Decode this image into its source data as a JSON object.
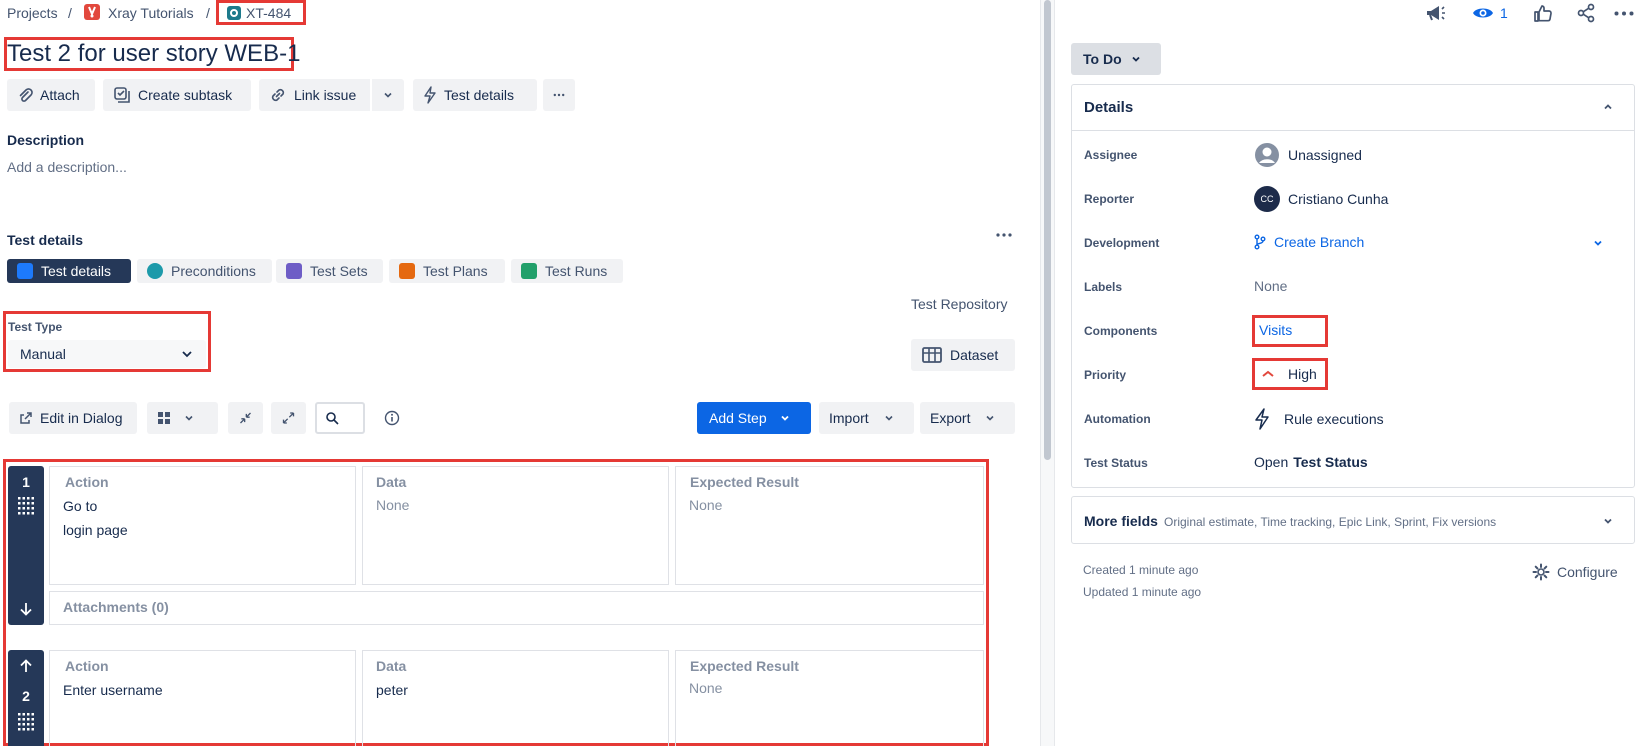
{
  "breadcrumb": {
    "projects": "Projects",
    "sep": "/",
    "project": "Xray Tutorials",
    "issue_key": "XT-484"
  },
  "issue": {
    "title": "Test 2 for user story WEB-1"
  },
  "toolbar": {
    "attach": "Attach",
    "create_subtask": "Create subtask",
    "link_issue": "Link issue",
    "test_details": "Test details"
  },
  "description": {
    "heading": "Description",
    "placeholder": "Add a description..."
  },
  "test_details": {
    "heading": "Test details",
    "tabs": [
      {
        "label": "Test details",
        "color": "#1d7afc"
      },
      {
        "label": "Preconditions",
        "color": "#1d9aaa"
      },
      {
        "label": "Test Sets",
        "color": "#6e5dc6"
      },
      {
        "label": "Test Plans",
        "color": "#e56910"
      },
      {
        "label": "Test Runs",
        "color": "#22a06b"
      }
    ],
    "repository": "Test Repository",
    "test_type_label": "Test Type",
    "test_type_value": "Manual",
    "dataset": "Dataset",
    "edit_in_dialog": "Edit in Dialog",
    "add_step": "Add Step",
    "import": "Import",
    "export": "Export"
  },
  "steps": [
    {
      "number": "1",
      "action_header": "Action",
      "data_header": "Data",
      "expected_header": "Expected Result",
      "action_line1": "Go to",
      "action_line2": "login page",
      "data": "None",
      "expected": "None",
      "attachments": "Attachments (0)"
    },
    {
      "number": "2",
      "action_header": "Action",
      "data_header": "Data",
      "expected_header": "Expected Result",
      "action_line1": "Enter username",
      "data": "peter",
      "expected": "None"
    }
  ],
  "top_actions": {
    "watch_count": "1"
  },
  "status_button": "To Do",
  "details_panel": {
    "heading": "Details",
    "assignee_label": "Assignee",
    "assignee_value": "Unassigned",
    "reporter_label": "Reporter",
    "reporter_initials": "CC",
    "reporter_value": "Cristiano Cunha",
    "development_label": "Development",
    "development_value": "Create Branch",
    "labels_label": "Labels",
    "labels_value": "None",
    "components_label": "Components",
    "components_value": "Visits",
    "priority_label": "Priority",
    "priority_value": "High",
    "automation_label": "Automation",
    "automation_value": "Rule executions",
    "test_status_label": "Test Status",
    "test_status_prefix": "Open",
    "test_status_value": "Test Status"
  },
  "more_fields": {
    "heading": "More fields",
    "sub": "Original estimate, Time tracking, Epic Link, Sprint, Fix versions"
  },
  "meta": {
    "created": "Created 1 minute ago",
    "updated": "Updated 1 minute ago",
    "configure": "Configure"
  },
  "colors": {
    "primary": "#0c66e4",
    "highlight": "#e53935",
    "dark": "#253858",
    "priority_high": "#e2483d"
  }
}
